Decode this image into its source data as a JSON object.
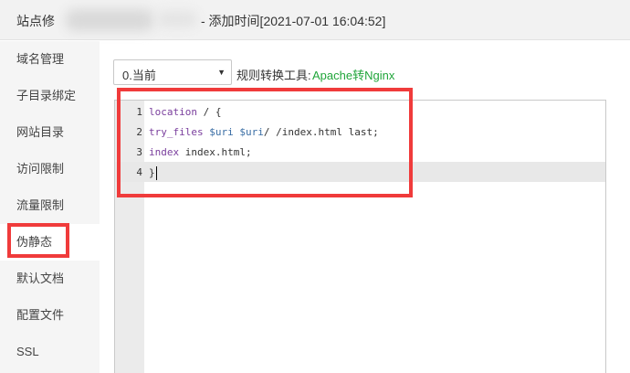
{
  "title": {
    "prefix": "站点修",
    "suffix": "- 添加时间[2021-07-01 16:04:52]"
  },
  "sidebar": {
    "items": [
      {
        "label": "域名管理"
      },
      {
        "label": "子目录绑定"
      },
      {
        "label": "网站目录"
      },
      {
        "label": "访问限制"
      },
      {
        "label": "流量限制"
      },
      {
        "label": "伪静态"
      },
      {
        "label": "默认文档"
      },
      {
        "label": "配置文件"
      },
      {
        "label": "SSL"
      }
    ],
    "active_index": 5
  },
  "toolbar": {
    "select_value": "0.当前",
    "tool_label": "规则转换工具:",
    "tool_link": "Apache转Nginx"
  },
  "editor": {
    "line_numbers": [
      "1",
      "2",
      "3",
      "4"
    ],
    "lines": {
      "l1_kw": "location",
      "l1_rest": " / {",
      "l2_kw": "try_files",
      "l2_var1": "$uri",
      "l2_var2": "$uri",
      "l2_tail": "/ /index.html last;",
      "l3_kw": "index",
      "l3_rest": " index.html;",
      "l4": "}"
    }
  },
  "colors": {
    "accent_green": "#20a53a",
    "highlight_red": "#f03b3b",
    "keyword": "#7a3e9d",
    "variable": "#3a6ea5"
  }
}
